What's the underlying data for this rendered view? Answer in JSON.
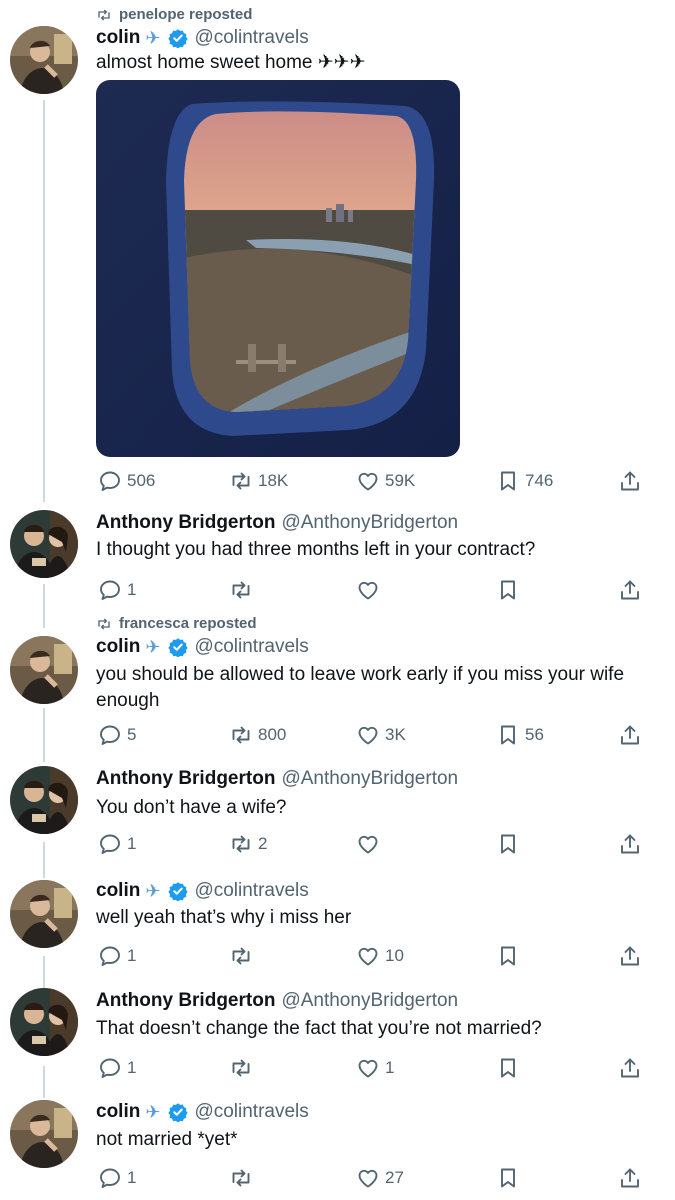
{
  "posts": [
    {
      "repost_label": "penelope reposted",
      "name": "colin",
      "plane": "✈",
      "verified": true,
      "handle": "@colintravels",
      "text": "almost home sweet home ✈✈✈",
      "has_media": true,
      "replies": "506",
      "retweets": "18K",
      "likes": "59K",
      "bookmarks": "746"
    },
    {
      "repost_label": "",
      "name": "Anthony Bridgerton",
      "verified": false,
      "handle": "@AnthonyBridgerton",
      "text": "I thought you had three months left in your contract?",
      "replies": "1",
      "retweets": "",
      "likes": "",
      "bookmarks": ""
    },
    {
      "repost_label": "francesca reposted",
      "name": "colin",
      "plane": "✈",
      "verified": true,
      "handle": "@colintravels",
      "text": "you should be allowed to leave work early if you miss your wife enough",
      "replies": "5",
      "retweets": "800",
      "likes": "3K",
      "bookmarks": "56"
    },
    {
      "repost_label": "",
      "name": "Anthony Bridgerton",
      "verified": false,
      "handle": "@AnthonyBridgerton",
      "text": "You don’t have a wife?",
      "replies": "1",
      "retweets": "2",
      "likes": "",
      "bookmarks": ""
    },
    {
      "repost_label": "",
      "name": "colin",
      "plane": "✈",
      "verified": true,
      "handle": "@colintravels",
      "text": "well yeah that’s why i miss her",
      "replies": "1",
      "retweets": "",
      "likes": "10",
      "bookmarks": ""
    },
    {
      "repost_label": "",
      "name": "Anthony Bridgerton",
      "verified": false,
      "handle": "@AnthonyBridgerton",
      "text": "That doesn’t change the fact that you’re not married?",
      "replies": "1",
      "retweets": "",
      "likes": "1",
      "bookmarks": ""
    },
    {
      "repost_label": "",
      "name": "colin",
      "plane": "✈",
      "verified": true,
      "handle": "@colintravels",
      "text": "not married *yet*",
      "replies": "1",
      "retweets": "",
      "likes": "27",
      "bookmarks": ""
    }
  ],
  "colors": {
    "verified": "#1d9bf0",
    "secondary_text": "#536471",
    "thread_line": "#cfd9de"
  },
  "icons": [
    "retweet-icon",
    "verified-badge-icon",
    "reply-icon",
    "like-icon",
    "bookmark-icon",
    "share-icon",
    "airplane-icon"
  ]
}
